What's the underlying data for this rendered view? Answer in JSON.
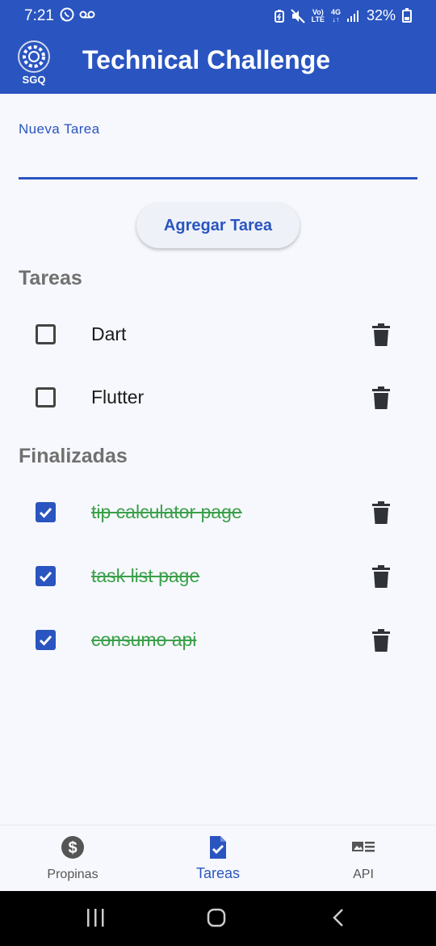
{
  "status_bar": {
    "time": "7:21",
    "network_top": "Vo)",
    "network_bottom": "LTE",
    "gen": "4G",
    "battery": "32%"
  },
  "app_bar": {
    "logo_text": "SGQ",
    "title": "Technical Challenge"
  },
  "form": {
    "label": "Nueva Tarea",
    "value": "",
    "button": "Agregar Tarea"
  },
  "sections": {
    "pending_title": "Tareas",
    "done_title": "Finalizadas"
  },
  "pending_tasks": [
    {
      "label": "Dart",
      "checked": false
    },
    {
      "label": "Flutter",
      "checked": false
    }
  ],
  "done_tasks": [
    {
      "label": "tip calculator page",
      "checked": true
    },
    {
      "label": "task list page",
      "checked": true
    },
    {
      "label": "consumo api",
      "checked": true
    }
  ],
  "bottom_nav": [
    {
      "label": "Propinas",
      "icon": "dollar-circle-icon",
      "active": false
    },
    {
      "label": "Tareas",
      "icon": "task-check-icon",
      "active": true
    },
    {
      "label": "API",
      "icon": "image-list-icon",
      "active": false
    }
  ],
  "colors": {
    "primary": "#2a55c0",
    "done_text": "#3aa04a",
    "background": "#f7f8fd"
  }
}
